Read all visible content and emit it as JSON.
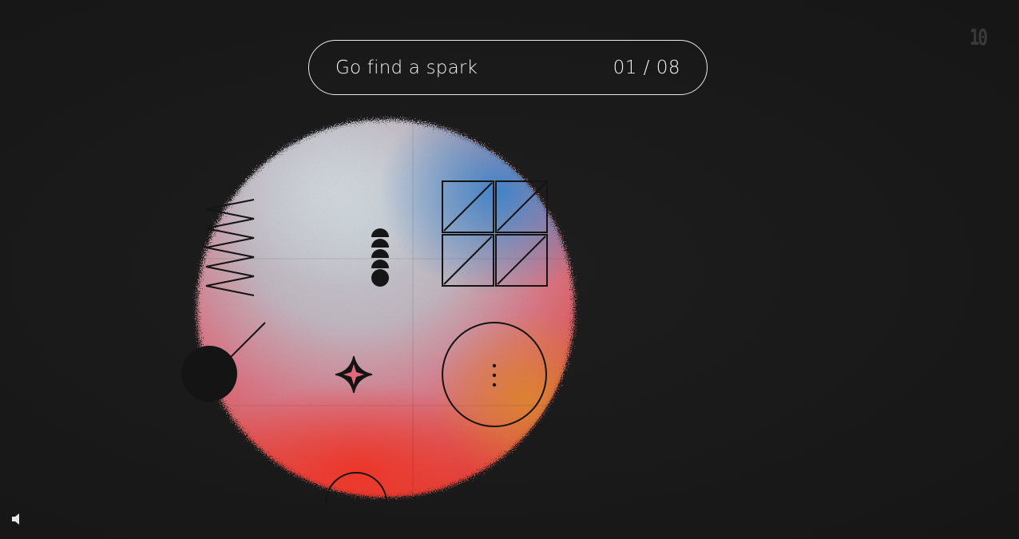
{
  "header": {
    "title": "Go find a spark",
    "counter": "01 / 08"
  },
  "logo": {
    "text": "10"
  },
  "icons": {
    "sound": "speaker-icon",
    "sparkle": "four-point-star-icon"
  },
  "colors": {
    "background": "#1b1b1b",
    "pill_border": "#e8e8e8",
    "orb_top": "#c9d4df",
    "orb_blue": "#4a8fd4",
    "orb_pink": "#e47b8a",
    "orb_red": "#f23a2a",
    "orb_orange": "#e8872e"
  }
}
